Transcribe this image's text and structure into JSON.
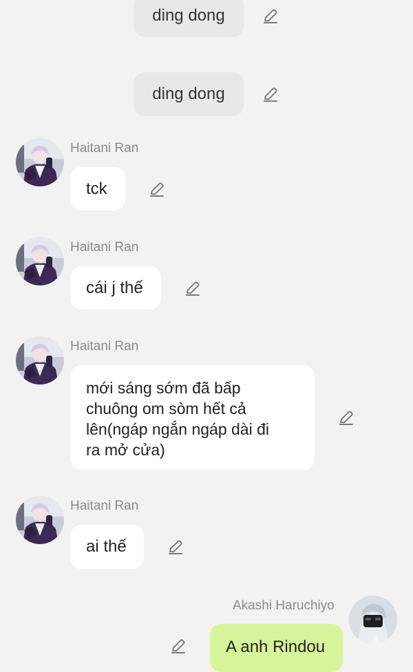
{
  "messages": {
    "sys1": {
      "text": "ding dong"
    },
    "sys2": {
      "text": "ding dong"
    },
    "m1": {
      "sender": "Haitani Ran",
      "text": "tck"
    },
    "m2": {
      "sender": "Haitani Ran",
      "text": "cái j thế"
    },
    "m3": {
      "sender": "Haitani Ran",
      "text": "mới sáng sớm đã bấp chuông om sòm hết cả lên(ngáp ngắn ngáp dài đi ra mở cửa)"
    },
    "m4": {
      "sender": "Haitani Ran",
      "text": "ai thế"
    },
    "m5": {
      "sender": "Akashi Haruchiyo",
      "text": "A anh Rindou"
    }
  },
  "icons": {
    "edit": "pencil-edit-icon",
    "avatar_ran": "avatar-haitani-ran",
    "avatar_akashi": "avatar-akashi-haruchiyo"
  },
  "colors": {
    "background": "#f2f2f2",
    "incoming_bubble": "#ffffff",
    "outgoing_bubble": "#d8f49b",
    "system_bubble": "#e8e8e8",
    "sender_name": "#8a8a8a"
  }
}
